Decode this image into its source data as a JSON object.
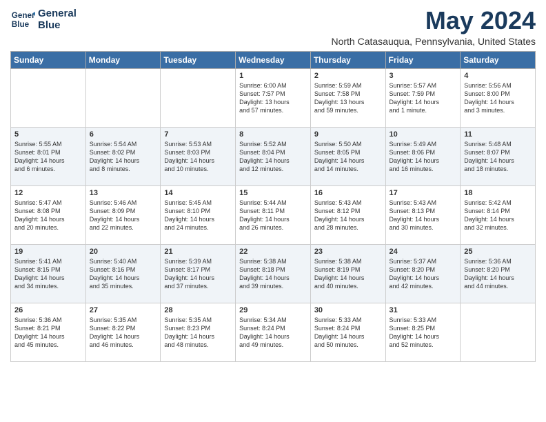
{
  "header": {
    "logo_line1": "General",
    "logo_line2": "Blue",
    "month": "May 2024",
    "location": "North Catasauqua, Pennsylvania, United States"
  },
  "days_of_week": [
    "Sunday",
    "Monday",
    "Tuesday",
    "Wednesday",
    "Thursday",
    "Friday",
    "Saturday"
  ],
  "weeks": [
    [
      {
        "day": "",
        "info": ""
      },
      {
        "day": "",
        "info": ""
      },
      {
        "day": "",
        "info": ""
      },
      {
        "day": "1",
        "info": "Sunrise: 6:00 AM\nSunset: 7:57 PM\nDaylight: 13 hours\nand 57 minutes."
      },
      {
        "day": "2",
        "info": "Sunrise: 5:59 AM\nSunset: 7:58 PM\nDaylight: 13 hours\nand 59 minutes."
      },
      {
        "day": "3",
        "info": "Sunrise: 5:57 AM\nSunset: 7:59 PM\nDaylight: 14 hours\nand 1 minute."
      },
      {
        "day": "4",
        "info": "Sunrise: 5:56 AM\nSunset: 8:00 PM\nDaylight: 14 hours\nand 3 minutes."
      }
    ],
    [
      {
        "day": "5",
        "info": "Sunrise: 5:55 AM\nSunset: 8:01 PM\nDaylight: 14 hours\nand 6 minutes."
      },
      {
        "day": "6",
        "info": "Sunrise: 5:54 AM\nSunset: 8:02 PM\nDaylight: 14 hours\nand 8 minutes."
      },
      {
        "day": "7",
        "info": "Sunrise: 5:53 AM\nSunset: 8:03 PM\nDaylight: 14 hours\nand 10 minutes."
      },
      {
        "day": "8",
        "info": "Sunrise: 5:52 AM\nSunset: 8:04 PM\nDaylight: 14 hours\nand 12 minutes."
      },
      {
        "day": "9",
        "info": "Sunrise: 5:50 AM\nSunset: 8:05 PM\nDaylight: 14 hours\nand 14 minutes."
      },
      {
        "day": "10",
        "info": "Sunrise: 5:49 AM\nSunset: 8:06 PM\nDaylight: 14 hours\nand 16 minutes."
      },
      {
        "day": "11",
        "info": "Sunrise: 5:48 AM\nSunset: 8:07 PM\nDaylight: 14 hours\nand 18 minutes."
      }
    ],
    [
      {
        "day": "12",
        "info": "Sunrise: 5:47 AM\nSunset: 8:08 PM\nDaylight: 14 hours\nand 20 minutes."
      },
      {
        "day": "13",
        "info": "Sunrise: 5:46 AM\nSunset: 8:09 PM\nDaylight: 14 hours\nand 22 minutes."
      },
      {
        "day": "14",
        "info": "Sunrise: 5:45 AM\nSunset: 8:10 PM\nDaylight: 14 hours\nand 24 minutes."
      },
      {
        "day": "15",
        "info": "Sunrise: 5:44 AM\nSunset: 8:11 PM\nDaylight: 14 hours\nand 26 minutes."
      },
      {
        "day": "16",
        "info": "Sunrise: 5:43 AM\nSunset: 8:12 PM\nDaylight: 14 hours\nand 28 minutes."
      },
      {
        "day": "17",
        "info": "Sunrise: 5:43 AM\nSunset: 8:13 PM\nDaylight: 14 hours\nand 30 minutes."
      },
      {
        "day": "18",
        "info": "Sunrise: 5:42 AM\nSunset: 8:14 PM\nDaylight: 14 hours\nand 32 minutes."
      }
    ],
    [
      {
        "day": "19",
        "info": "Sunrise: 5:41 AM\nSunset: 8:15 PM\nDaylight: 14 hours\nand 34 minutes."
      },
      {
        "day": "20",
        "info": "Sunrise: 5:40 AM\nSunset: 8:16 PM\nDaylight: 14 hours\nand 35 minutes."
      },
      {
        "day": "21",
        "info": "Sunrise: 5:39 AM\nSunset: 8:17 PM\nDaylight: 14 hours\nand 37 minutes."
      },
      {
        "day": "22",
        "info": "Sunrise: 5:38 AM\nSunset: 8:18 PM\nDaylight: 14 hours\nand 39 minutes."
      },
      {
        "day": "23",
        "info": "Sunrise: 5:38 AM\nSunset: 8:19 PM\nDaylight: 14 hours\nand 40 minutes."
      },
      {
        "day": "24",
        "info": "Sunrise: 5:37 AM\nSunset: 8:20 PM\nDaylight: 14 hours\nand 42 minutes."
      },
      {
        "day": "25",
        "info": "Sunrise: 5:36 AM\nSunset: 8:20 PM\nDaylight: 14 hours\nand 44 minutes."
      }
    ],
    [
      {
        "day": "26",
        "info": "Sunrise: 5:36 AM\nSunset: 8:21 PM\nDaylight: 14 hours\nand 45 minutes."
      },
      {
        "day": "27",
        "info": "Sunrise: 5:35 AM\nSunset: 8:22 PM\nDaylight: 14 hours\nand 46 minutes."
      },
      {
        "day": "28",
        "info": "Sunrise: 5:35 AM\nSunset: 8:23 PM\nDaylight: 14 hours\nand 48 minutes."
      },
      {
        "day": "29",
        "info": "Sunrise: 5:34 AM\nSunset: 8:24 PM\nDaylight: 14 hours\nand 49 minutes."
      },
      {
        "day": "30",
        "info": "Sunrise: 5:33 AM\nSunset: 8:24 PM\nDaylight: 14 hours\nand 50 minutes."
      },
      {
        "day": "31",
        "info": "Sunrise: 5:33 AM\nSunset: 8:25 PM\nDaylight: 14 hours\nand 52 minutes."
      },
      {
        "day": "",
        "info": ""
      }
    ]
  ]
}
